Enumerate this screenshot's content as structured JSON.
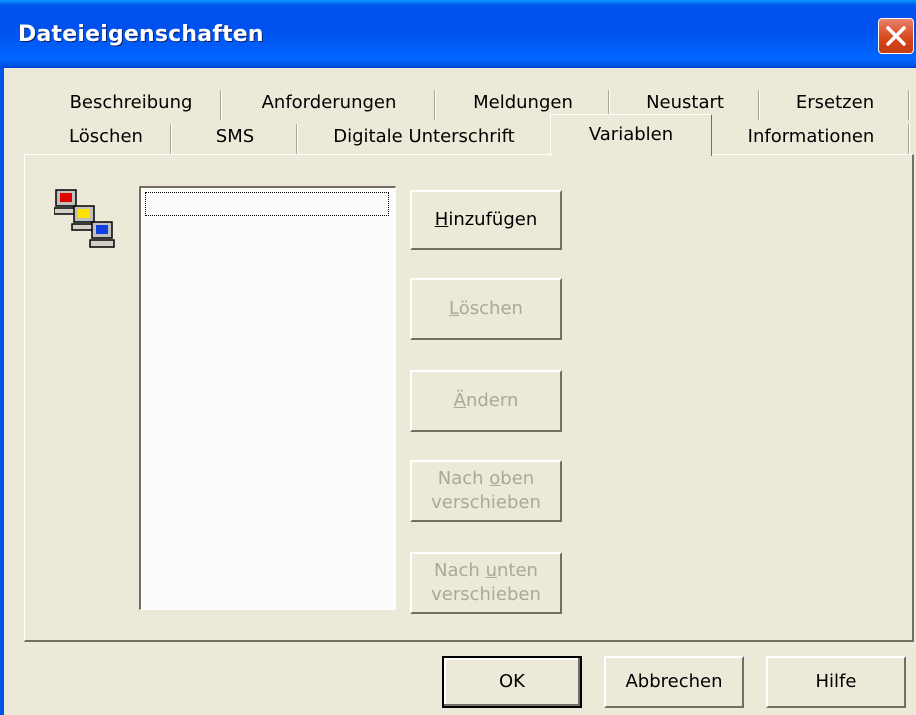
{
  "window": {
    "title": "Dateieigenschaften"
  },
  "tabs": {
    "row1": [
      "Beschreibung",
      "Anforderungen",
      "Meldungen",
      "Neustart",
      "Ersetzen"
    ],
    "row2": [
      "Löschen",
      "SMS",
      "Digitale Unterschrift",
      "Variablen",
      "Informationen"
    ],
    "active": "Variablen"
  },
  "variables_list": {
    "items": []
  },
  "side_buttons": {
    "add": {
      "label_pre": "",
      "mnemonic": "H",
      "label_post": "inzufügen",
      "enabled": true
    },
    "delete": {
      "label_pre": "",
      "mnemonic": "L",
      "label_post": "öschen",
      "enabled": false
    },
    "edit": {
      "label_pre": "",
      "mnemonic": "Ä",
      "label_post": "ndern",
      "enabled": false
    },
    "move_up": {
      "line1_pre": "Nach ",
      "mnemonic": "o",
      "line1_post": "ben",
      "line2": "verschieben",
      "enabled": false
    },
    "move_down": {
      "line1_pre": "Nach ",
      "mnemonic": "u",
      "line1_post": "nten",
      "line2": "verschieben",
      "enabled": false
    }
  },
  "footer": {
    "ok": "OK",
    "cancel": "Abbrechen",
    "help": "Hilfe"
  },
  "icons": {
    "variables": "network-computers-icon",
    "close": "close-icon"
  },
  "colors": {
    "titlebar": "#0055ea",
    "face": "#ece9d8",
    "close": "#d74418",
    "disabled_text": "#aca899"
  }
}
